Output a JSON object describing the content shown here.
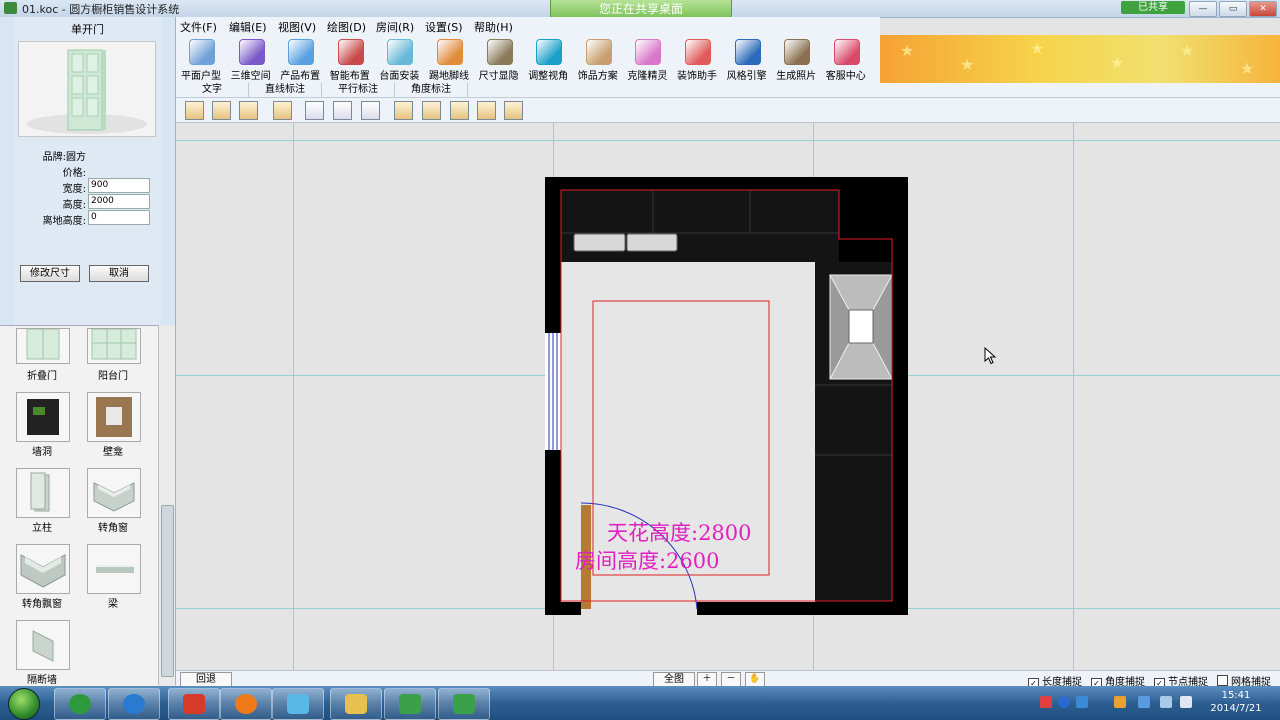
{
  "window": {
    "title": "01.koc - 圆方橱柜销售设计系统",
    "share_banner": "您正在共享桌面",
    "shared_badge": "已共享",
    "controls": [
      "—",
      "▭",
      "✕"
    ]
  },
  "menu": [
    "文件(F)",
    "编辑(E)",
    "视图(V)",
    "绘图(D)",
    "房间(R)",
    "设置(S)",
    "帮助(H)"
  ],
  "toolbar": [
    {
      "label": "平面户型",
      "icon": "floorplan-icon",
      "color": "#6fa0d8"
    },
    {
      "label": "三维空间",
      "icon": "cube-icon",
      "color": "#7a58c8"
    },
    {
      "label": "产品布置",
      "icon": "product-layout-icon",
      "color": "#58a0e0"
    },
    {
      "label": "智能布置",
      "icon": "smart-layout-icon",
      "color": "#c84a4a"
    },
    {
      "label": "台面安装",
      "icon": "countertop-icon",
      "color": "#68b8d8"
    },
    {
      "label": "踢地脚线",
      "icon": "baseboard-icon",
      "color": "#e08a3a"
    },
    {
      "label": "尺寸显隐",
      "icon": "dimension-icon",
      "color": "#8a7a5a"
    },
    {
      "label": "调整视角",
      "icon": "wifi-view-icon",
      "color": "#1aa0c8"
    },
    {
      "label": "饰品方案",
      "icon": "decor-icon",
      "color": "#c8a070"
    },
    {
      "label": "克隆精灵",
      "icon": "clone-wizard-icon",
      "color": "#d878c8"
    },
    {
      "label": "装饰助手",
      "icon": "decor-assistant-icon",
      "color": "#e05a5a"
    },
    {
      "label": "风格引擎",
      "icon": "globe-icon",
      "color": "#2a6ab8"
    },
    {
      "label": "生成照片",
      "icon": "photo-icon",
      "color": "#8a7050"
    },
    {
      "label": "客服中心",
      "icon": "service-icon",
      "color": "#d84a6a"
    }
  ],
  "subtabs": [
    "文字",
    "直线标注",
    "平行标注",
    "角度标注"
  ],
  "left_panel": {
    "title": "单开门",
    "brand_label": "品牌:",
    "brand_value": "圆方",
    "price_label": "价格:",
    "width_label": "宽度:",
    "width_value": "900",
    "height_label": "高度:",
    "height_value": "2000",
    "elevation_label": "离地高度:",
    "elevation_value": "0",
    "modify_button": "修改尺寸",
    "cancel_button": "取消"
  },
  "catalog": [
    {
      "label": "折叠门"
    },
    {
      "label": "阳台门"
    },
    {
      "label": "墙洞"
    },
    {
      "label": "壁龛"
    },
    {
      "label": "立柱"
    },
    {
      "label": "转角窗"
    },
    {
      "label": "转角飘窗"
    },
    {
      "label": "梁"
    },
    {
      "label": "隔断墙"
    }
  ],
  "canvas": {
    "ceiling_height_text": "天花高度:2800",
    "room_height_text": "房间高度:2600"
  },
  "bottom_bar": {
    "back": "回退",
    "fullview": "全图",
    "snaps": [
      {
        "label": "长度捕捉",
        "checked": true
      },
      {
        "label": "角度捕捉",
        "checked": true
      },
      {
        "label": "节点捕捉",
        "checked": true
      },
      {
        "label": "网格捕捉",
        "checked": false
      }
    ]
  },
  "taskbar": {
    "time": "15:41",
    "date": "2014/7/21"
  }
}
